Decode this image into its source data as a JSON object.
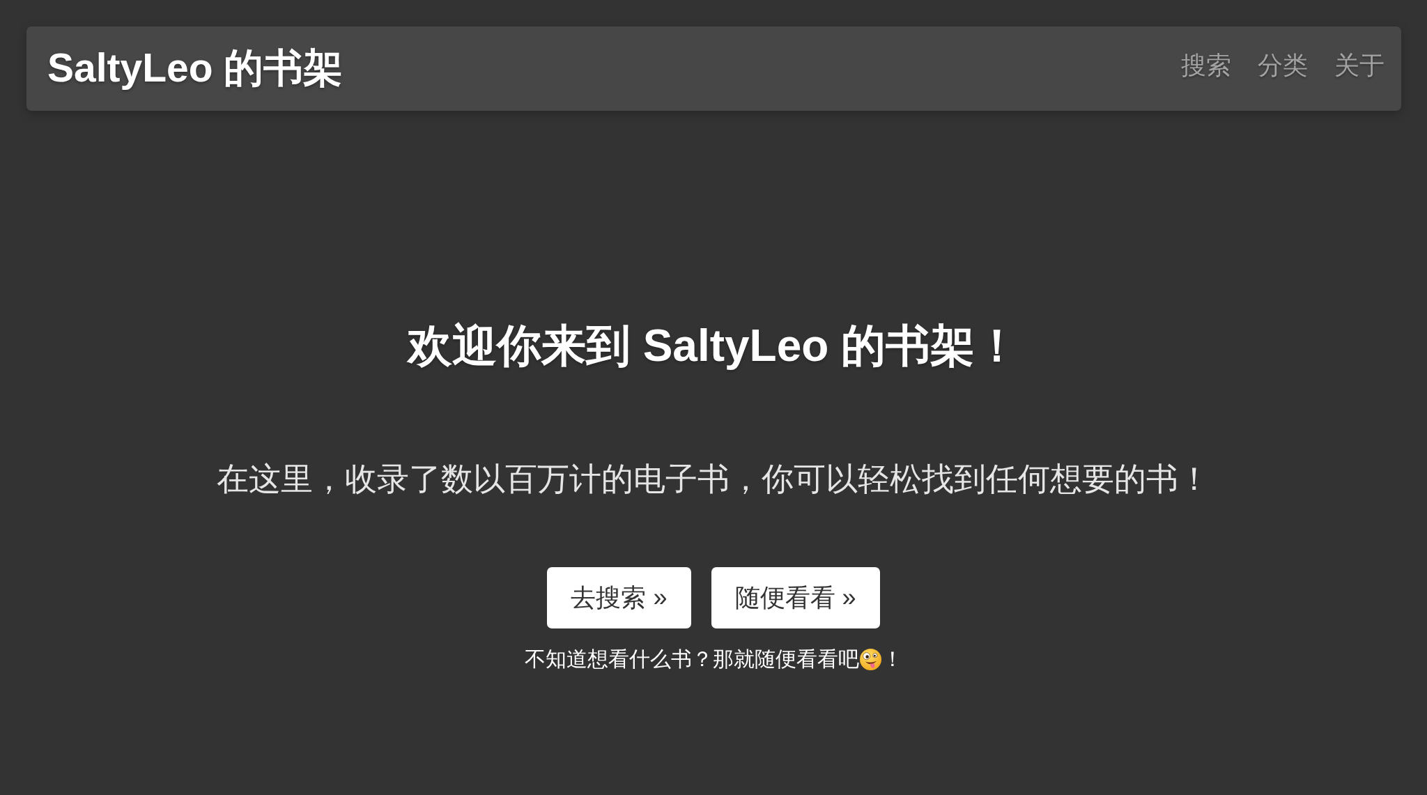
{
  "navbar": {
    "brand": "SaltyLeo 的书架",
    "links": [
      "搜索",
      "分类",
      "关于"
    ]
  },
  "hero": {
    "heading": "欢迎你来到 SaltyLeo 的书架！",
    "subtitle": "在这里，收录了数以百万计的电子书，你可以轻松找到任何想要的书！",
    "buttons": [
      "去搜索 »",
      "随便看看 »"
    ],
    "caption": {
      "text": "不知道想看什么书？那就随便看看吧",
      "suffix": "！"
    }
  }
}
